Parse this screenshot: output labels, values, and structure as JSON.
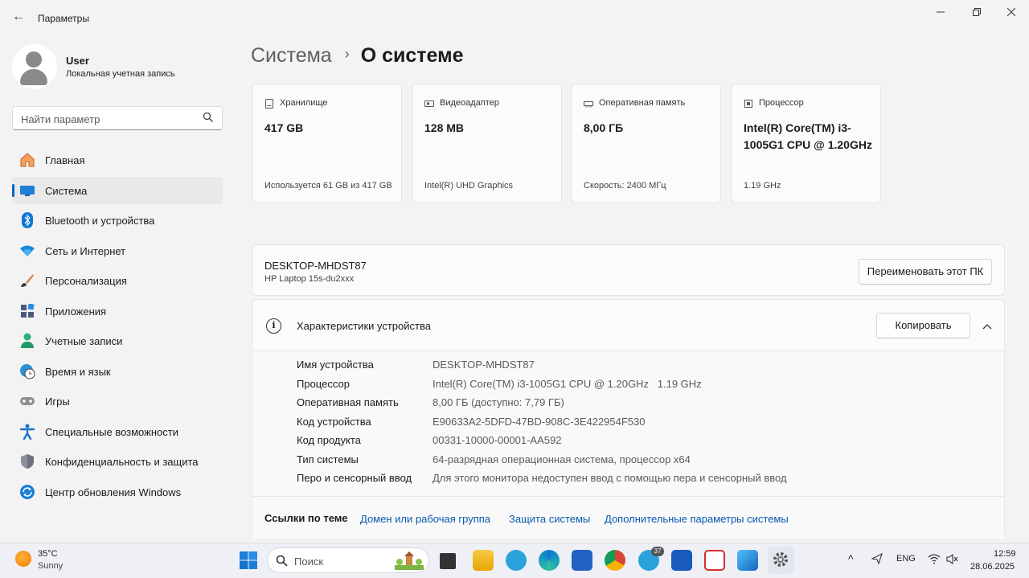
{
  "titlebar": {
    "title": "Параметры"
  },
  "user": {
    "name": "User",
    "type": "Локальная учетная запись"
  },
  "search": {
    "placeholder": "Найти параметр"
  },
  "sidebar": {
    "items": [
      {
        "label": "Главная",
        "icon": "home-icon"
      },
      {
        "label": "Система",
        "icon": "monitor-icon",
        "active": true
      },
      {
        "label": "Bluetooth и устройства",
        "icon": "bluetooth-icon"
      },
      {
        "label": "Сеть и Интернет",
        "icon": "wifi-icon"
      },
      {
        "label": "Персонализация",
        "icon": "brush-icon"
      },
      {
        "label": "Приложения",
        "icon": "apps-icon"
      },
      {
        "label": "Учетные записи",
        "icon": "account-icon"
      },
      {
        "label": "Время и язык",
        "icon": "globe-clock-icon"
      },
      {
        "label": "Игры",
        "icon": "gamepad-icon"
      },
      {
        "label": "Специальные возможности",
        "icon": "accessibility-icon"
      },
      {
        "label": "Конфиденциальность и защита",
        "icon": "shield-icon"
      },
      {
        "label": "Центр обновления Windows",
        "icon": "update-icon"
      }
    ]
  },
  "breadcrumb": {
    "parent": "Система",
    "separator": "›",
    "current": "О системе"
  },
  "cards": [
    {
      "title": "Хранилище",
      "value": "417 GB",
      "sub": "Используется 61 GB из 417 GB",
      "icon": "storage-icon"
    },
    {
      "title": "Видеоадаптер",
      "value": "128 MB",
      "sub": "Intel(R) UHD Graphics",
      "icon": "gpu-icon"
    },
    {
      "title": "Оперативная память",
      "value": "8,00 ГБ",
      "sub": "Скорость: 2400 МГц",
      "icon": "ram-icon"
    },
    {
      "title": "Процессор",
      "value": "Intel(R) Core(TM) i3-1005G1 CPU @ 1.20GHz",
      "sub": "1.19 GHz",
      "icon": "cpu-icon"
    }
  ],
  "device": {
    "name": "DESKTOP-MHDST87",
    "model": "HP Laptop 15s-du2xxx",
    "rename_label": "Переименовать этот ПК"
  },
  "specs": {
    "title": "Характеристики устройства",
    "copy_label": "Копировать",
    "rows": [
      {
        "label": "Имя устройства",
        "value": "DESKTOP-MHDST87"
      },
      {
        "label": "Процессор",
        "value": "Intel(R) Core(TM) i3-1005G1 CPU @ 1.20GHz   1.19 GHz"
      },
      {
        "label": "Оперативная память",
        "value": "8,00 ГБ (доступно: 7,79 ГБ)"
      },
      {
        "label": "Код устройства",
        "value": "E90633A2-5DFD-47BD-908C-3E422954F530"
      },
      {
        "label": "Код продукта",
        "value": "00331-10000-00001-AA592"
      },
      {
        "label": "Тип системы",
        "value": "64-разрядная операционная система, процессор x64"
      },
      {
        "label": "Перо и сенсорный ввод",
        "value": "Для этого монитора недоступен ввод с помощью пера и сенсорный ввод"
      }
    ]
  },
  "related": {
    "title": "Ссылки по теме",
    "links": [
      "Домен или рабочая группа",
      "Защита системы",
      "Дополнительные параметры системы"
    ]
  },
  "taskbar": {
    "weather_temp": "35°C",
    "weather_cond": "Sunny",
    "search_placeholder": "Поиск",
    "telegram_badge": "37",
    "language": "ENG",
    "time": "12:59",
    "date": "28.06.2025"
  },
  "colors": {
    "accent": "#0067c0",
    "link": "#0a58b0"
  }
}
